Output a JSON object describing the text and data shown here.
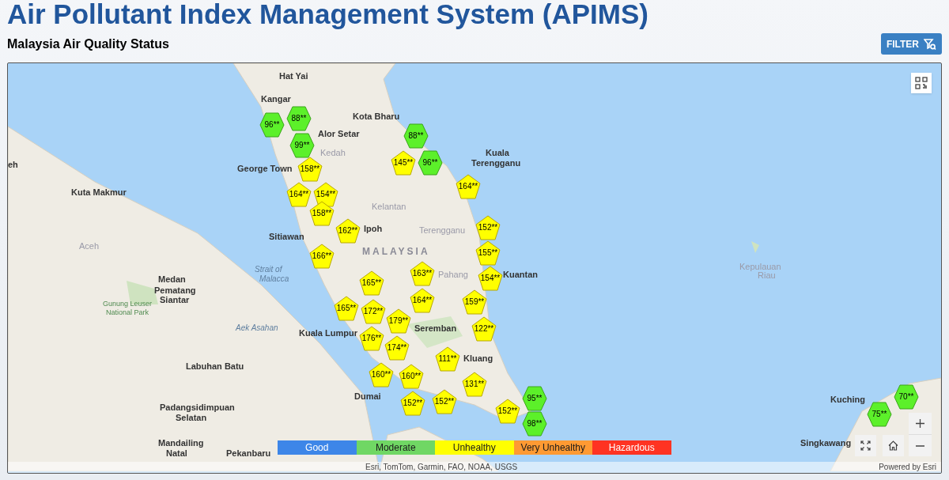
{
  "header": {
    "title": "Air Pollutant Index Management System (APIMS)",
    "subtitle": "Malaysia Air Quality Status",
    "filter_button": "FILTER"
  },
  "map": {
    "places": [
      {
        "label": "Hat Yai",
        "kind": "city"
      },
      {
        "label": "Kangar",
        "kind": "city"
      },
      {
        "label": "Alor Setar",
        "kind": "city"
      },
      {
        "label": "Kedah",
        "kind": "region"
      },
      {
        "label": "George Town",
        "kind": "city"
      },
      {
        "label": "Kota Bharu",
        "kind": "city"
      },
      {
        "label": "Kuala",
        "kind": "city"
      },
      {
        "label": "Terengganu",
        "kind": "city"
      },
      {
        "label": "Kelantan",
        "kind": "region"
      },
      {
        "label": "Terengganu",
        "kind": "region"
      },
      {
        "label": "Ipoh",
        "kind": "city"
      },
      {
        "label": "Sitiawan",
        "kind": "city"
      },
      {
        "label": "MALAYSIA",
        "kind": "country"
      },
      {
        "label": "Pahang",
        "kind": "region"
      },
      {
        "label": "Kuantan",
        "kind": "city"
      },
      {
        "label": "Kuala Lumpur",
        "kind": "city"
      },
      {
        "label": "Seremban",
        "kind": "city"
      },
      {
        "label": "Kluang",
        "kind": "city"
      },
      {
        "label": "Dumai",
        "kind": "city"
      },
      {
        "label": "eh",
        "kind": "city"
      },
      {
        "label": "Kuta Makmur",
        "kind": "city"
      },
      {
        "label": "Aceh",
        "kind": "region"
      },
      {
        "label": "Medan",
        "kind": "city"
      },
      {
        "label": "Strait of",
        "kind": "water"
      },
      {
        "label": "Malacca",
        "kind": "water"
      },
      {
        "label": "Gunung Leuser",
        "kind": "park"
      },
      {
        "label": "National Park",
        "kind": "park"
      },
      {
        "label": "Pematang",
        "kind": "city"
      },
      {
        "label": "Siantar",
        "kind": "city"
      },
      {
        "label": "Aek Asahan",
        "kind": "water"
      },
      {
        "label": "Labuhan Batu",
        "kind": "city"
      },
      {
        "label": "Padangsidimpuan",
        "kind": "city"
      },
      {
        "label": "Selatan",
        "kind": "city"
      },
      {
        "label": "Mandailing",
        "kind": "city"
      },
      {
        "label": "Natal",
        "kind": "city"
      },
      {
        "label": "Pekanbaru",
        "kind": "city"
      },
      {
        "label": "Kepulauan",
        "kind": "region"
      },
      {
        "label": "Riau",
        "kind": "region"
      },
      {
        "label": "Singkawang",
        "kind": "city"
      },
      {
        "label": "Kuching",
        "kind": "city"
      }
    ],
    "markers": [
      {
        "label": "96**",
        "kind": "moderate"
      },
      {
        "label": "88**",
        "kind": "moderate"
      },
      {
        "label": "99**",
        "kind": "moderate"
      },
      {
        "label": "158**",
        "kind": "unhealthy"
      },
      {
        "label": "154**",
        "kind": "unhealthy"
      },
      {
        "label": "164**",
        "kind": "unhealthy"
      },
      {
        "label": "88**",
        "kind": "moderate"
      },
      {
        "label": "145**",
        "kind": "unhealthy"
      },
      {
        "label": "96**",
        "kind": "moderate"
      },
      {
        "label": "164**",
        "kind": "unhealthy"
      },
      {
        "label": "158**",
        "kind": "unhealthy"
      },
      {
        "label": "162**",
        "kind": "unhealthy"
      },
      {
        "label": "166**",
        "kind": "unhealthy"
      },
      {
        "label": "152**",
        "kind": "unhealthy"
      },
      {
        "label": "155**",
        "kind": "unhealthy"
      },
      {
        "label": "154**",
        "kind": "unhealthy"
      },
      {
        "label": "159**",
        "kind": "unhealthy"
      },
      {
        "label": "163**",
        "kind": "unhealthy"
      },
      {
        "label": "165**",
        "kind": "unhealthy"
      },
      {
        "label": "164**",
        "kind": "unhealthy"
      },
      {
        "label": "165**",
        "kind": "unhealthy"
      },
      {
        "label": "172**",
        "kind": "unhealthy"
      },
      {
        "label": "179**",
        "kind": "unhealthy"
      },
      {
        "label": "176**",
        "kind": "unhealthy"
      },
      {
        "label": "174**",
        "kind": "unhealthy"
      },
      {
        "label": "122**",
        "kind": "unhealthy"
      },
      {
        "label": "160**",
        "kind": "unhealthy"
      },
      {
        "label": "160**",
        "kind": "unhealthy"
      },
      {
        "label": "111**",
        "kind": "unhealthy"
      },
      {
        "label": "152**",
        "kind": "unhealthy"
      },
      {
        "label": "131**",
        "kind": "unhealthy"
      },
      {
        "label": "152**",
        "kind": "unhealthy"
      },
      {
        "label": "152**",
        "kind": "unhealthy"
      },
      {
        "label": "95**",
        "kind": "moderate"
      },
      {
        "label": "98**",
        "kind": "moderate"
      },
      {
        "label": "75**",
        "kind": "moderate"
      },
      {
        "label": "70**",
        "kind": "moderate"
      }
    ],
    "legend": [
      {
        "label": "Good",
        "color": "#3d86e8"
      },
      {
        "label": "Moderate",
        "color": "#70d764"
      },
      {
        "label": "Unhealthy",
        "color": "#ffff00"
      },
      {
        "label": "Very Unhealthy",
        "color": "#ff9a33"
      },
      {
        "label": "Hazardous",
        "color": "#ff3322"
      }
    ],
    "attribution": "Esri, TomTom, Garmin, FAO, NOAA, USGS",
    "powered_by": "Powered by Esri"
  }
}
